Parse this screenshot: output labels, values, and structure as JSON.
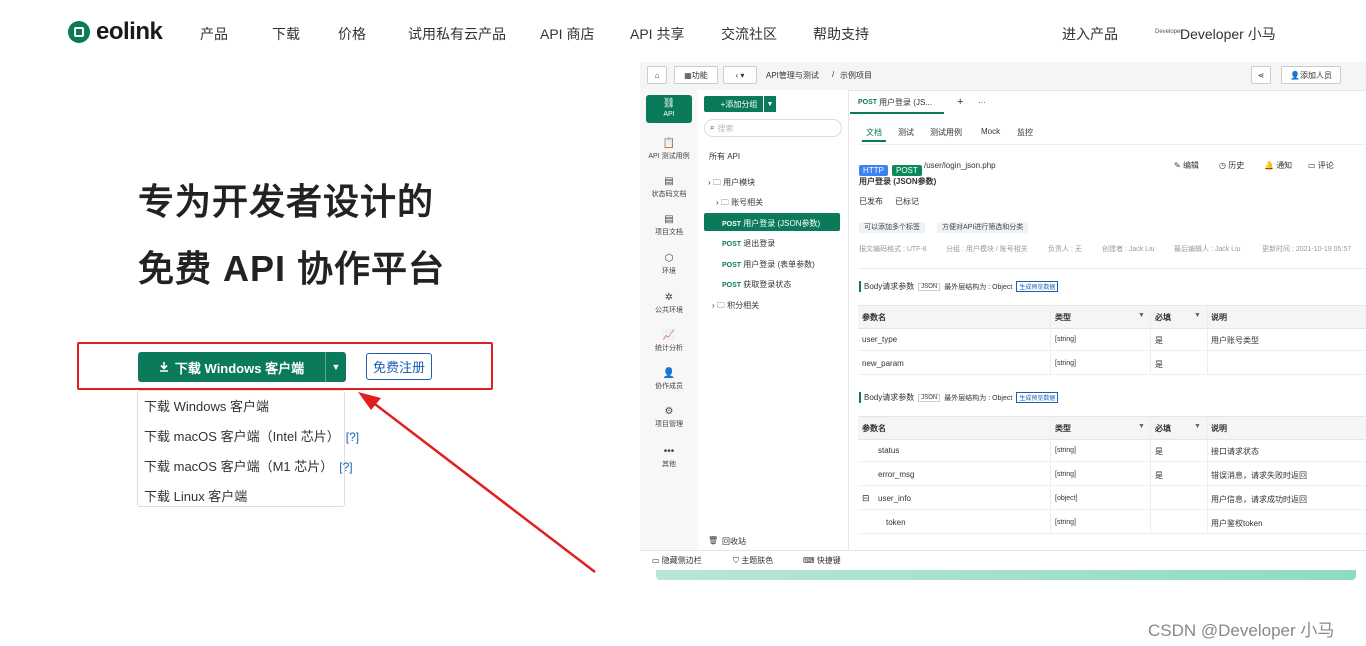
{
  "nav": {
    "logo_text": "eolink",
    "items": [
      "产品",
      "下载",
      "价格",
      "试用私有云产品",
      "API 商店",
      "API 共享",
      "交流社区",
      "帮助支持"
    ],
    "enter_product": "进入产品",
    "user_name": "Developer 小马",
    "avatar_text": "Developer"
  },
  "hero": {
    "line1": "专为开发者设计的",
    "line2": "免费 API 协作平台"
  },
  "download": {
    "button_label": "下载 Windows 客户端",
    "download_icon": "download-icon",
    "register_label": "免费注册",
    "menu": [
      {
        "label": "下载 Windows 客户端",
        "help": ""
      },
      {
        "label": "下载 macOS 客户端（Intel 芯片）",
        "help": "[?]"
      },
      {
        "label": "下载 macOS 客户端（M1 芯片）",
        "help": "[?]"
      },
      {
        "label": "下载 Linux 客户端",
        "help": ""
      }
    ]
  },
  "preview": {
    "toolbar": {
      "func_label": "功能",
      "breadcrumb_1": "API管理与测试",
      "breadcrumb_sep": "/",
      "breadcrumb_2": "示例项目",
      "add_member": "添加人员"
    },
    "sidebar": [
      {
        "icon": "link-icon",
        "label": "API"
      },
      {
        "icon": "clipboard-icon",
        "label": "API 测试用例"
      },
      {
        "icon": "doc-icon",
        "label": "状态码文档"
      },
      {
        "icon": "doc-icon",
        "label": "项目文档"
      },
      {
        "icon": "cube-icon",
        "label": "环境"
      },
      {
        "icon": "puzzle-icon",
        "label": "公共环境"
      },
      {
        "icon": "chart-icon",
        "label": "统计分析"
      },
      {
        "icon": "user-icon",
        "label": "协作成员"
      },
      {
        "icon": "gear-icon",
        "label": "项目管理"
      },
      {
        "icon": "more-icon",
        "label": "其他"
      }
    ],
    "tree": {
      "add_group": "添加分组",
      "search_placeholder": "搜索",
      "all_api": "所有 API",
      "items": [
        {
          "method": "",
          "label": "用户模块"
        },
        {
          "method": "",
          "label": "账号相关"
        },
        {
          "method": "POST",
          "label": "用户登录 (JSON参数)"
        },
        {
          "method": "POST",
          "label": "退出登录"
        },
        {
          "method": "POST",
          "label": "用户登录 (表单参数)"
        },
        {
          "method": "POST",
          "label": "获取登录状态"
        },
        {
          "method": "",
          "label": "积分相关"
        }
      ],
      "recycle": "回收站"
    },
    "tab": {
      "method": "POST",
      "title": "用户登录 (JS...",
      "plus": "+",
      "dots": "···"
    },
    "subtabs": [
      "文档",
      "测试",
      "测试用例",
      "Mock",
      "监控"
    ],
    "api": {
      "http": "HTTP",
      "method": "POST",
      "path": "/user/login_json.php",
      "name": "用户登录 (JSON参数)",
      "status1": "已发布",
      "status2": "已标记",
      "tag1": "可以添加多个标签",
      "tag2": "方便对API进行筛选和分类",
      "actions": [
        "编辑",
        "历史",
        "通知",
        "评论"
      ],
      "meta": [
        "报文编码格式 : UTF-8",
        "分组 : 用户模块 / 账号相关",
        "负责人 : 无",
        "创建者 : Jack Liu",
        "最后编辑人 : Jack Liu",
        "更新时间 : 2021-10-19 05:57"
      ]
    },
    "request": {
      "title": "Body请求参数",
      "fmt": "JSON",
      "outer": "最外层结构为 : Object",
      "gen": "生成预览数据",
      "headers": [
        "参数名",
        "类型",
        "必填",
        "说明"
      ],
      "rows": [
        {
          "name": "user_type",
          "type": "[string]",
          "req": "是",
          "desc": "用户账号类型"
        },
        {
          "name": "new_param",
          "type": "[string]",
          "req": "是",
          "desc": ""
        }
      ]
    },
    "response": {
      "title": "Body请求参数",
      "fmt": "JSON",
      "outer": "最外层结构为 : Object",
      "gen": "生成预览数据",
      "headers": [
        "参数名",
        "类型",
        "必填",
        "说明"
      ],
      "rows": [
        {
          "name": "status",
          "type": "[string]",
          "req": "是",
          "desc": "接口请求状态"
        },
        {
          "name": "error_msg",
          "type": "[string]",
          "req": "是",
          "desc": "错误消息，请求失败时返回"
        },
        {
          "name": "user_info",
          "type": "[object]",
          "req": "",
          "desc": "用户信息，请求成功时返回"
        },
        {
          "name": "token",
          "type": "[string]",
          "req": "",
          "desc": "用户鉴权token"
        }
      ]
    },
    "bottom": [
      "隐藏侧边栏",
      "主题肤色",
      "快捷键"
    ]
  },
  "watermark": "CSDN @Developer 小马",
  "colors": {
    "brand": "#0a7a5a",
    "annotation": "#e02020",
    "link": "#1a5fb4"
  }
}
